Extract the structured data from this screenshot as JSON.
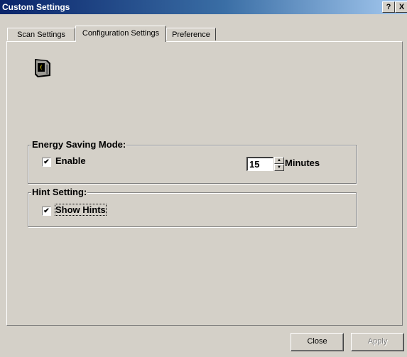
{
  "window": {
    "title": "Custom Settings",
    "help_label": "?",
    "close_label": "X"
  },
  "tabs": [
    {
      "label": "Scan Settings",
      "active": false
    },
    {
      "label": "Configuration Settings",
      "active": true
    },
    {
      "label": "Preference",
      "active": false
    }
  ],
  "energy": {
    "legend": "Energy Saving Mode:",
    "enable_label": "Enable",
    "enable_checked": true,
    "checkmark": "✔",
    "minutes_value": "15",
    "minutes_label": "Minutes"
  },
  "hint": {
    "legend": "Hint Setting:",
    "show_hints_label": "Show Hints",
    "show_hints_checked": true,
    "checkmark": "✔"
  },
  "buttons": {
    "close_label": "Close",
    "apply_label": "Apply"
  },
  "icons": {
    "monitor": "monitor-icon"
  },
  "colors": {
    "title_start": "#0a246a",
    "title_end": "#a6caf0",
    "face": "#d4d0c8"
  }
}
